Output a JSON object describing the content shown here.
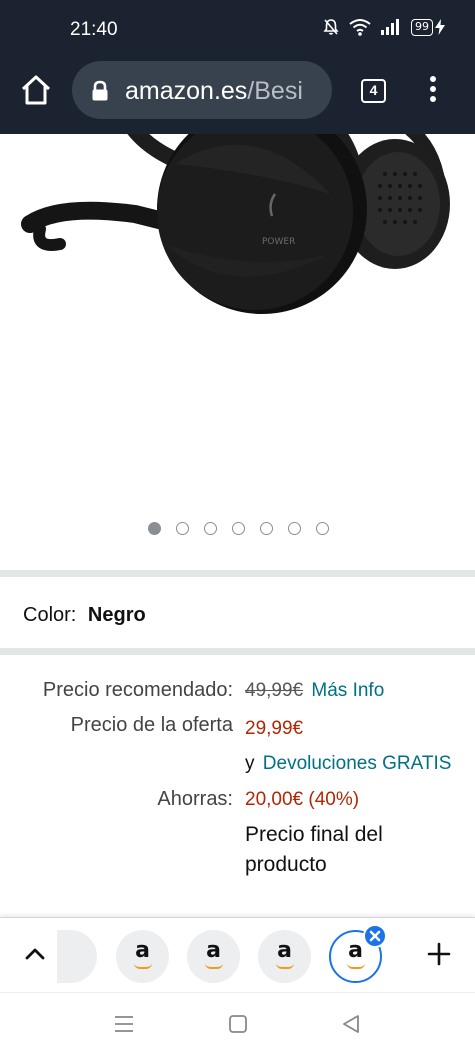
{
  "status_bar": {
    "time": "21:40",
    "battery": "99"
  },
  "browser": {
    "url_domain": "amazon.es",
    "url_path": "/Besi",
    "tab_count": "4",
    "icons": [
      "home-icon",
      "lock-icon",
      "tabs-icon",
      "overflow-menu-icon"
    ]
  },
  "product": {
    "image_text": "POWER",
    "carousel": {
      "total": 7,
      "active_index": 0
    },
    "color_label": "Color:",
    "color_value": "Negro"
  },
  "pricing": {
    "recommended_label": "Precio recomendado:",
    "recommended_value": "49,99€",
    "more_info_link": "Más Info",
    "offer_label": "Precio de la oferta",
    "offer_value": "29,99€",
    "returns_prefix": "y",
    "returns_link": "Devoluciones GRATIS",
    "savings_label": "Ahorras:",
    "savings_value": "20,00€ (40%)",
    "final_price_note": "Precio final del producto"
  },
  "tab_strip": {
    "tab_letter": "a",
    "tabs": 5
  },
  "colors": {
    "chrome_bg": "#1b2330",
    "link": "#007185",
    "price_red": "#b12704",
    "active_tab": "#1a73e8"
  }
}
